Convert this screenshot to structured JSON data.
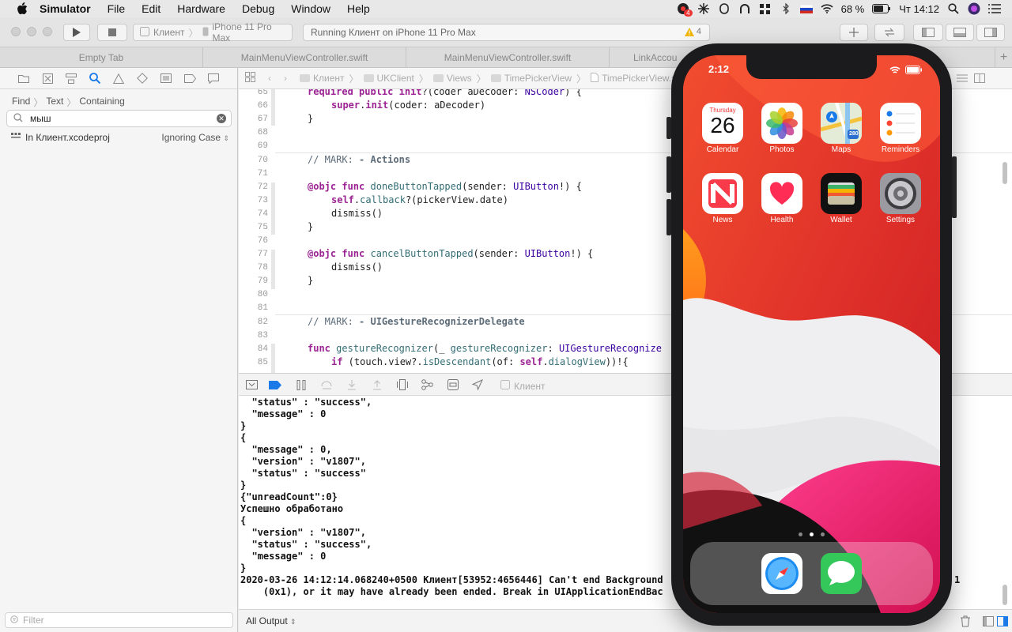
{
  "menubar": {
    "app_name": "Simulator",
    "items": [
      "File",
      "Edit",
      "Hardware",
      "Debug",
      "Window",
      "Help"
    ],
    "badge_count": "4",
    "battery": "68 %",
    "clock": "Чт 14:12"
  },
  "toolbar": {
    "scheme": "Клиент",
    "device": "iPhone 11 Pro Max",
    "activity": "Running Клиент on iPhone 11 Pro Max",
    "warning_count": "4"
  },
  "tabs": [
    "Empty Tab",
    "MainMenuViewController.swift",
    "MainMenuViewController.swift",
    "LinkAccou"
  ],
  "navigator": {
    "find_path": [
      "Find",
      "Text",
      "Containing"
    ],
    "search_value": "мыш",
    "scope": "In Клиент.xcodeproj",
    "ignore_case": "Ignoring Case",
    "filter_placeholder": "Filter"
  },
  "jumpbar": [
    "Клиент",
    "UKClient",
    "Views",
    "TimePickerView",
    "TimePickerView.swift"
  ],
  "code_lines": [
    {
      "n": "65",
      "t": "required public init?(coder aDecoder: NSCoder) {"
    },
    {
      "n": "66",
      "t": "super.init(coder: aDecoder)"
    },
    {
      "n": "67",
      "t": "}"
    },
    {
      "n": "68",
      "t": ""
    },
    {
      "n": "69",
      "t": ""
    },
    {
      "n": "70",
      "t": "// MARK: - Actions"
    },
    {
      "n": "71",
      "t": ""
    },
    {
      "n": "72",
      "t": "@objc func doneButtonTapped(sender: UIButton!) {"
    },
    {
      "n": "73",
      "t": "self.callback?(pickerView.date)"
    },
    {
      "n": "74",
      "t": "dismiss()"
    },
    {
      "n": "75",
      "t": "}"
    },
    {
      "n": "76",
      "t": ""
    },
    {
      "n": "77",
      "t": "@objc func cancelButtonTapped(sender: UIButton!) {"
    },
    {
      "n": "78",
      "t": "dismiss()"
    },
    {
      "n": "79",
      "t": "}"
    },
    {
      "n": "80",
      "t": ""
    },
    {
      "n": "81",
      "t": ""
    },
    {
      "n": "82",
      "t": "// MARK: - UIGestureRecognizerDelegate"
    },
    {
      "n": "83",
      "t": ""
    },
    {
      "n": "84",
      "t": "func gestureRecognizer(_ gestureRecognizer: UIGestureRecognize"
    },
    {
      "n": "85",
      "t": "if (touch.view?.isDescendant(of: self.dialogView))!{"
    }
  ],
  "debug": {
    "process": "Клиент"
  },
  "console_lines": [
    "  \"status\" : \"success\",",
    "  \"message\" : 0",
    "}",
    "{",
    "  \"message\" : 0,",
    "  \"version\" : \"v1807\",",
    "  \"status\" : \"success\"",
    "}",
    "{\"unreadCount\":0}",
    "Успешно обработано",
    "{",
    "  \"version\" : \"v1807\",",
    "  \"status\" : \"success\",",
    "  \"message\" : 0",
    "}",
    "2020-03-26 14:12:14.068240+0500 Клиент[53952:4656446] Can't end Background",
    "    (0x1), or it may have already been ended. Break in UIApplicationEndBac"
  ],
  "console_tail": "1",
  "console_footer": {
    "output_select": "All Output"
  },
  "phone": {
    "time": "2:12",
    "calendar_day": "Thursday",
    "calendar_date": "26",
    "apps": [
      "Calendar",
      "Photos",
      "Maps",
      "Reminders",
      "News",
      "Health",
      "Wallet",
      "Settings"
    ],
    "maps_shield": "280",
    "dock": [
      "Safari",
      "Messages"
    ]
  },
  "colors": {
    "keyword": "#9b2393",
    "type": "#3900a0",
    "function": "#326d74",
    "comment": "#5d6c79",
    "wallpaper_red": "#e43a2c"
  }
}
